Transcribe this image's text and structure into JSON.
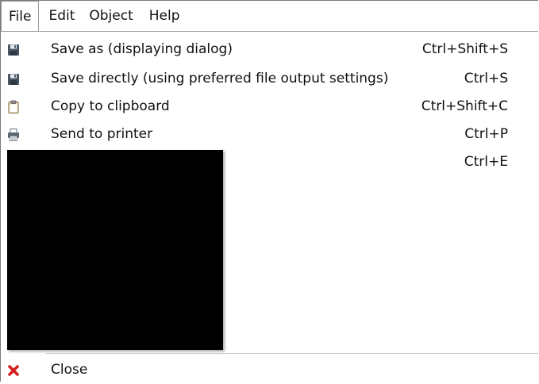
{
  "menubar": {
    "items": [
      {
        "label": "File",
        "active": true
      },
      {
        "label": "Edit",
        "active": false
      },
      {
        "label": "Object",
        "active": false
      },
      {
        "label": "Help",
        "active": false
      }
    ]
  },
  "file_menu": {
    "items": [
      {
        "icon": "floppy-disk-icon",
        "label": "Save as (displaying dialog)",
        "shortcut": "Ctrl+Shift+S"
      },
      {
        "icon": "floppy-disk-icon",
        "label": "Save directly (using preferred file output settings)",
        "shortcut": "Ctrl+S"
      },
      {
        "icon": "clipboard-icon",
        "label": "Copy to clipboard",
        "shortcut": "Ctrl+Shift+C"
      },
      {
        "icon": "printer-icon",
        "label": "Send to printer",
        "shortcut": "Ctrl+P"
      },
      {
        "icon": "",
        "label": "",
        "shortcut": "Ctrl+E"
      }
    ],
    "close": {
      "icon": "red-x-icon",
      "label": "Close"
    }
  },
  "colors": {
    "close_icon": "#d21f1f",
    "redacted_block": "#000000"
  }
}
